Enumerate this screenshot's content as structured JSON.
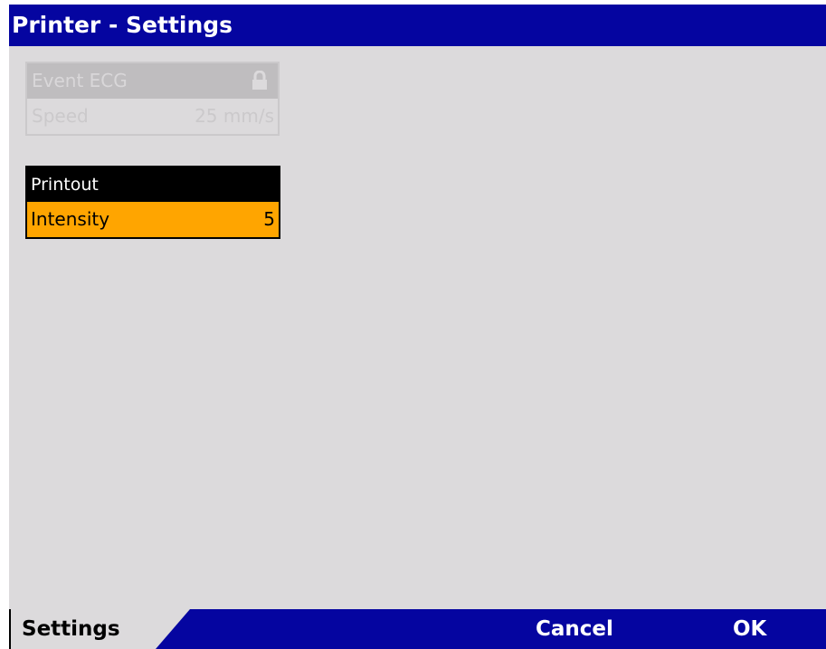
{
  "window": {
    "title": "Printer - Settings"
  },
  "event_ecg": {
    "title": "Event ECG",
    "lock_icon": "lock-icon",
    "speed_label": "Speed",
    "speed_value": "25 mm/s",
    "state": "disabled"
  },
  "printout": {
    "title": "Printout",
    "intensity_label": "Intensity",
    "intensity_value": "5",
    "state": "selected"
  },
  "softkeys": {
    "settings": "Settings",
    "cancel": "Cancel",
    "ok": "OK"
  },
  "colors": {
    "title_bar": "#0505a0",
    "background": "#dcdadc",
    "highlight": "#ffa500",
    "header_active": "#000000"
  }
}
